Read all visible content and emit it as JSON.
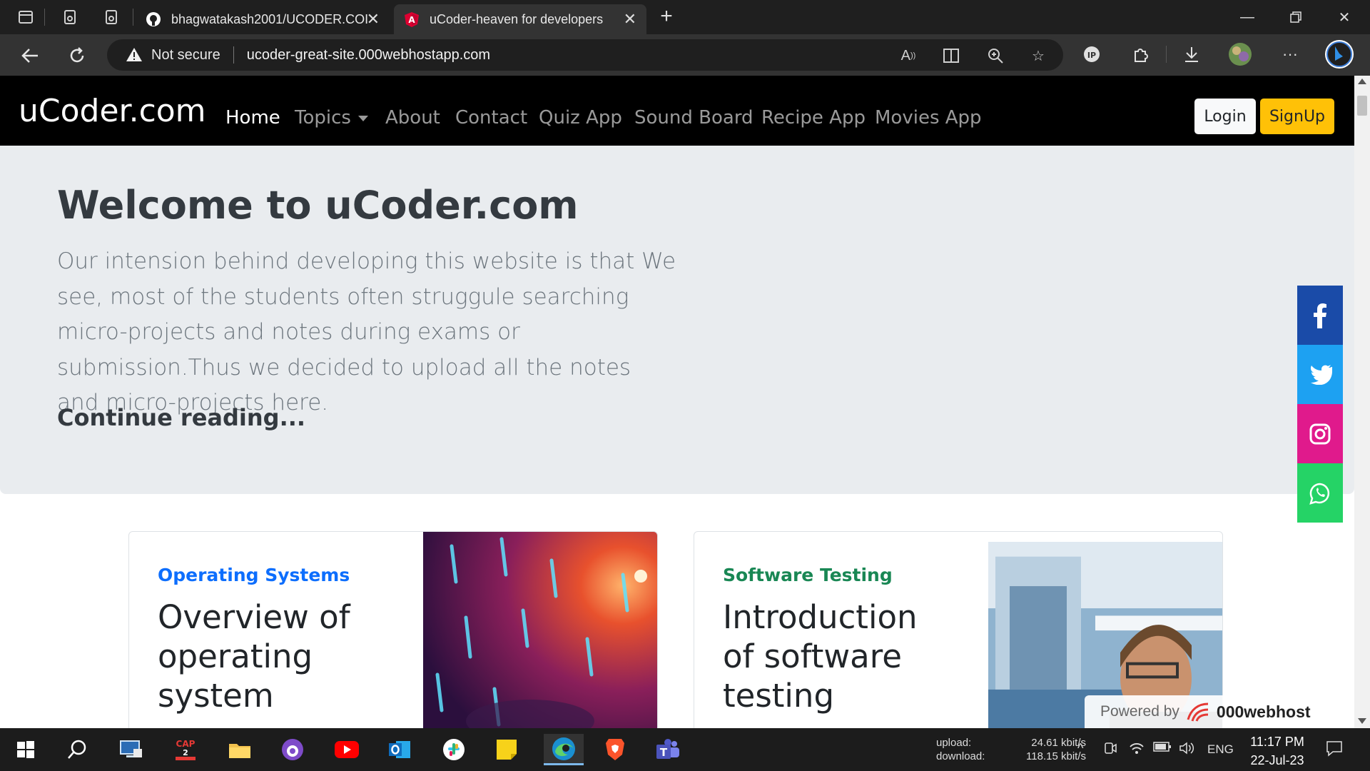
{
  "browser": {
    "tabs": [
      {
        "title": "bhagwatakash2001/UCODER.COI",
        "favicon": "github-icon",
        "active": false
      },
      {
        "title": "uCoder-heaven for developers",
        "favicon": "angular-icon",
        "active": true
      }
    ],
    "security_label": "Not secure",
    "url": "ucoder-great-site.000webhostapp.com"
  },
  "site": {
    "brand": "uCoder.com",
    "nav": [
      {
        "label": "Home",
        "active": true
      },
      {
        "label": "Topics",
        "dropdown": true
      },
      {
        "label": "About"
      },
      {
        "label": "Contact"
      },
      {
        "label": "Quiz App"
      },
      {
        "label": "Sound Board"
      },
      {
        "label": "Recipe App"
      },
      {
        "label": "Movies App"
      }
    ],
    "login_label": "Login",
    "signup_label": "SignUp",
    "jumbotron": {
      "title": "Welcome to uCoder.com",
      "text": "Our intension behind developing this website is that We see, most of the students often struggule searching micro-projects and notes during exams or submission.Thus we decided to upload all the notes and micro-projects here.",
      "link": "Continue reading..."
    },
    "social": [
      {
        "name": "facebook-icon",
        "color": "#1a4ba8"
      },
      {
        "name": "twitter-icon",
        "color": "#1da1f2"
      },
      {
        "name": "instagram-icon",
        "color": "#e01a8c"
      },
      {
        "name": "whatsapp-icon",
        "color": "#25d366"
      }
    ],
    "cards": [
      {
        "category": "Operating Systems",
        "category_color": "#0d6efd",
        "title": "Overview of operating system"
      },
      {
        "category": "Software Testing",
        "category_color": "#198754",
        "title": "Introduction of software testing"
      }
    ],
    "powered_by": {
      "prefix": "Powered by",
      "brand": "000webhost"
    }
  },
  "taskbar": {
    "network": {
      "upload_label": "upload:",
      "download_label": "download:",
      "upload_value": "24.61 kbit/s",
      "download_value": "118.15 kbit/s"
    },
    "language": "ENG",
    "time": "11:17 PM",
    "date": "22-Jul-23",
    "apps": [
      "start-icon",
      "search-icon",
      "remote-desktop-icon",
      "capcut-icon",
      "file-explorer-icon",
      "tor-icon",
      "youtube-icon",
      "outlook-icon",
      "slack-icon",
      "sticky-notes-icon",
      "edge-icon",
      "brave-icon",
      "teams-icon"
    ]
  }
}
